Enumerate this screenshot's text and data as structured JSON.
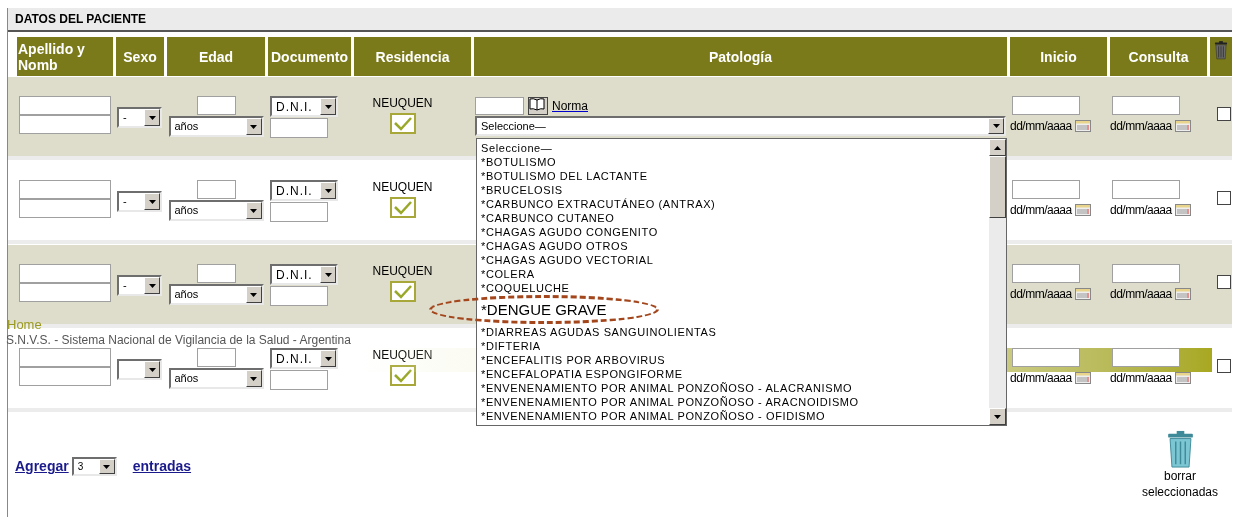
{
  "section_title": "DATOS DEL PACIENTE",
  "columns": [
    "Apellido y Nomb",
    "Sexo",
    "Edad",
    "Documento",
    "Residencia",
    "Patología",
    "Inicio",
    "Consulta"
  ],
  "rows": [
    {
      "sexo": "-",
      "edad_unit": "años",
      "documento_type": "D.N.I.",
      "residencia": "NEUQUEN",
      "residencia_checked": true,
      "patologia": {
        "norma_link": "Norma",
        "select_value": "Seleccione—"
      },
      "inicio_hint": "dd/mm/aaaa",
      "consulta_hint": "dd/mm/aaaa",
      "selected": false
    },
    {
      "sexo": "-",
      "edad_unit": "años",
      "documento_type": "D.N.I.",
      "residencia": "NEUQUEN",
      "residencia_checked": true,
      "inicio_hint": "dd/mm/aaaa",
      "consulta_hint": "dd/mm/aaaa",
      "selected": false
    },
    {
      "sexo": "-",
      "edad_unit": "años",
      "documento_type": "D.N.I.",
      "residencia": "NEUQUEN",
      "residencia_checked": true,
      "inicio_hint": "dd/mm/aaaa",
      "consulta_hint": "dd/mm/aaaa",
      "selected": false
    },
    {
      "sexo": "",
      "edad_unit": "años",
      "documento_type": "D.N.I.",
      "residencia": "NEUQUEN",
      "residencia_checked": true,
      "inicio_hint": "dd/mm/aaaa",
      "consulta_hint": "dd/mm/aaaa",
      "selected": false
    }
  ],
  "dropdown_list": {
    "options": [
      {
        "label": "Seleccione—",
        "emphasized": false
      },
      {
        "label": "*BOTULISMO",
        "emphasized": false
      },
      {
        "label": "*BOTULISMO DEL LACTANTE",
        "emphasized": false
      },
      {
        "label": "*BRUCELOSIS",
        "emphasized": false
      },
      {
        "label": "*CARBUNCO EXTRACUTÁNEO (ANTRAX)",
        "emphasized": false
      },
      {
        "label": "*CARBUNCO CUTANEO",
        "emphasized": false
      },
      {
        "label": "*CHAGAS AGUDO CONGENITO",
        "emphasized": false
      },
      {
        "label": "*CHAGAS AGUDO OTROS",
        "emphasized": false
      },
      {
        "label": "*CHAGAS AGUDO VECTORIAL",
        "emphasized": false
      },
      {
        "label": "*COLERA",
        "emphasized": false
      },
      {
        "label": "*COQUELUCHE",
        "emphasized": false
      },
      {
        "label": "*DENGUE GRAVE",
        "emphasized": true
      },
      {
        "label": "*DIARREAS AGUDAS SANGUINOLIENTAS",
        "emphasized": false
      },
      {
        "label": "*DIFTERIA",
        "emphasized": false
      },
      {
        "label": "*ENCEFALITIS POR ARBOVIRUS",
        "emphasized": false
      },
      {
        "label": "*ENCEFALOPATIA ESPONGIFORME",
        "emphasized": false
      },
      {
        "label": "*ENVENENAMIENTO POR ANIMAL PONZOÑOSO - ALACRANISMO",
        "emphasized": false
      },
      {
        "label": "*ENVENENAMIENTO POR ANIMAL PONZOÑOSO - ARACNOIDISMO",
        "emphasized": false
      },
      {
        "label": "*ENVENENAMIENTO POR ANIMAL PONZOÑOSO - OFIDISMO",
        "emphasized": false
      }
    ]
  },
  "overlay": {
    "home_link": "Home",
    "caption": "S.N.V.S. - Sistema Nacional de Vigilancia de la Salud - Argentina"
  },
  "footer": {
    "add_link": "Agregar",
    "count": "3",
    "entries_link": "entradas",
    "delete_label": "borrar seleccionadas"
  }
}
